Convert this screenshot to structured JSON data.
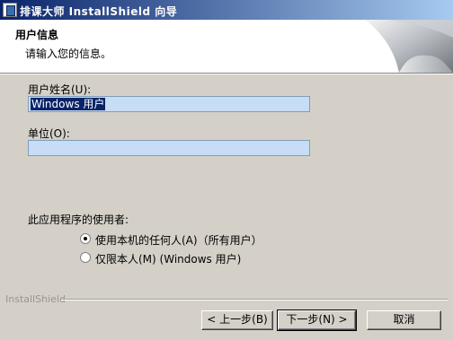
{
  "window": {
    "title": "排课大师 InstallShield 向导"
  },
  "header": {
    "title": "用户信息",
    "subtitle": "请输入您的信息。"
  },
  "form": {
    "username_label": "用户姓名(U):",
    "username_value": "Windows 用户",
    "org_label": "单位(O):",
    "org_value": ""
  },
  "usage": {
    "label": "此应用程序的使用者:",
    "options": [
      {
        "label": "使用本机的任何人(A)（所有用户）",
        "selected": true
      },
      {
        "label": "仅限本人(M) (Windows 用户)",
        "selected": false
      }
    ]
  },
  "footer": {
    "brand": "InstallShield"
  },
  "buttons": {
    "back": "< 上一步(B)",
    "next": "下一步(N) >",
    "cancel": "取消"
  },
  "colors": {
    "title_gradient_start": "#0a246a",
    "field_bg": "#c7dcf5",
    "dialog_bg": "#d4d0c8"
  }
}
